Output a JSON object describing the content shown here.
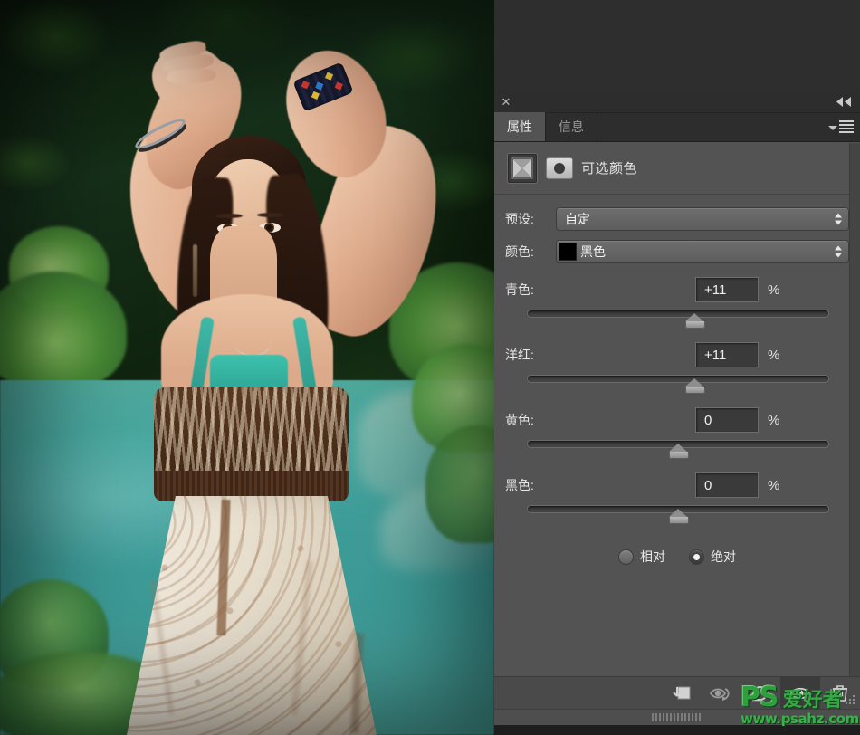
{
  "window": {
    "close_label": "✕",
    "collapse_icon": "double-chevron-left-icon"
  },
  "tabs": [
    {
      "label": "属性",
      "name": "tab-properties",
      "active": true
    },
    {
      "label": "信息",
      "name": "tab-info",
      "active": false
    }
  ],
  "panel_menu_icon": "panel-menu-icon",
  "adjustment": {
    "icon": "selective-color-adjustment-icon",
    "mask_icon": "layer-mask-thumbnail-icon",
    "title": "可选颜色"
  },
  "preset": {
    "label": "预设:",
    "value": "自定"
  },
  "color": {
    "label": "颜色:",
    "value": "黑色",
    "swatch_hex": "#000000"
  },
  "sliders": [
    {
      "name": "cyan",
      "label": "青色:",
      "value": "+11",
      "unit": "%",
      "percent": 55.5
    },
    {
      "name": "magenta",
      "label": "洋红:",
      "value": "+11",
      "unit": "%",
      "percent": 55.5
    },
    {
      "name": "yellow",
      "label": "黄色:",
      "value": "0",
      "unit": "%",
      "percent": 50
    },
    {
      "name": "black",
      "label": "黑色:",
      "value": "0",
      "unit": "%",
      "percent": 50
    }
  ],
  "method": {
    "relative": {
      "label": "相对",
      "checked": false
    },
    "absolute": {
      "label": "绝对",
      "checked": true
    }
  },
  "footer_buttons": [
    {
      "name": "clip-to-layer-button",
      "icon": "clip-to-layer-icon"
    },
    {
      "name": "preview-previous-button",
      "icon": "eye-arrow-icon"
    },
    {
      "name": "reset-button",
      "icon": "reset-arrow-icon"
    },
    {
      "name": "toggle-visibility-button",
      "icon": "eye-icon",
      "active": true
    },
    {
      "name": "delete-button",
      "icon": "trash-icon"
    }
  ],
  "watermark": {
    "ps": "PS",
    "cn": "爱好者",
    "url": "www.psahz.com"
  },
  "colors": {
    "panel_bg": "#535353",
    "tabbar_bg": "#2d2d2d",
    "field_bg": "#3a3a3a",
    "accent_green": "#2f9e3f"
  }
}
